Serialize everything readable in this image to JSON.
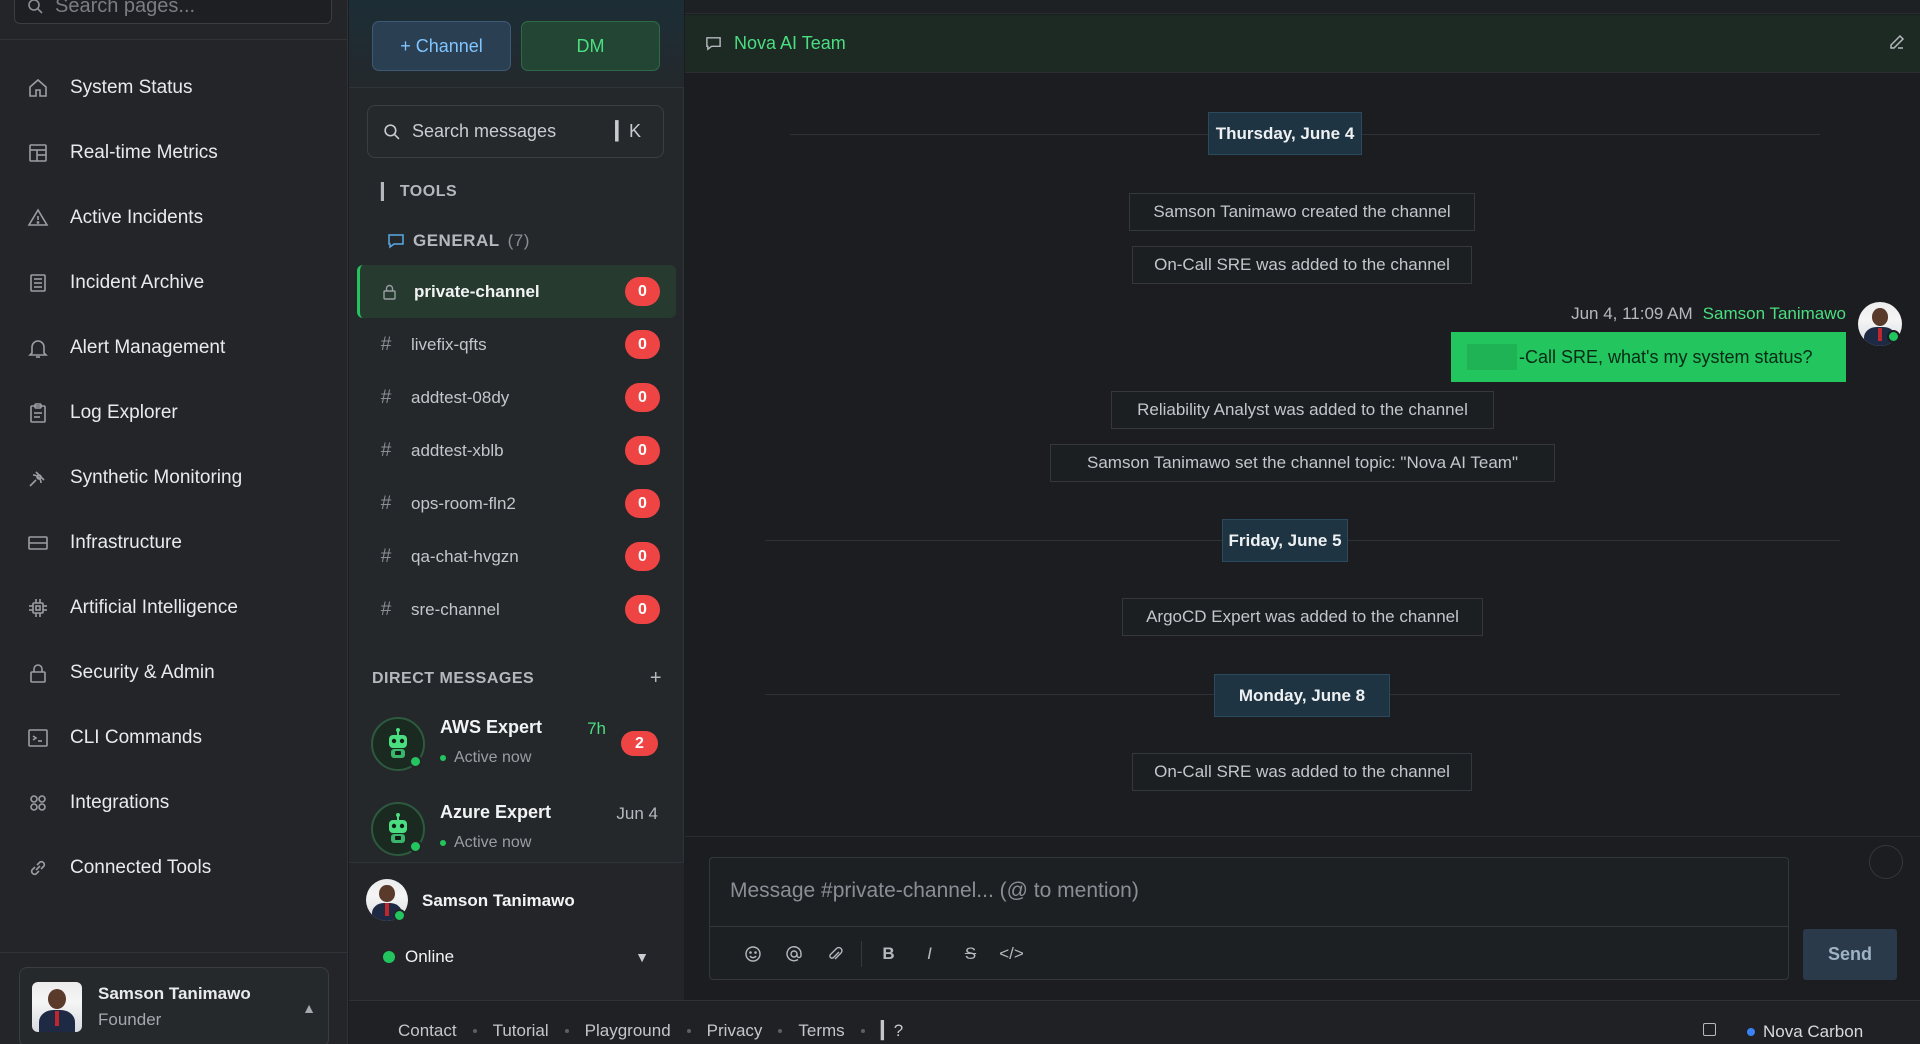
{
  "nav": {
    "search_placeholder": "Search pages...",
    "items": [
      {
        "label": "System Status",
        "icon": "home-icon"
      },
      {
        "label": "Real-time Metrics",
        "icon": "dashboard-icon"
      },
      {
        "label": "Active Incidents",
        "icon": "warning-icon"
      },
      {
        "label": "Incident Archive",
        "icon": "archive-icon"
      },
      {
        "label": "Alert Management",
        "icon": "bell-icon"
      },
      {
        "label": "Log Explorer",
        "icon": "clipboard-icon"
      },
      {
        "label": "Synthetic Monitoring",
        "icon": "satellite-icon"
      },
      {
        "label": "Infrastructure",
        "icon": "server-icon"
      },
      {
        "label": "Artificial Intelligence",
        "icon": "chip-icon"
      },
      {
        "label": "Security & Admin",
        "icon": "lock-icon"
      },
      {
        "label": "CLI Commands",
        "icon": "terminal-icon"
      },
      {
        "label": "Integrations",
        "icon": "grid-icon"
      },
      {
        "label": "Connected Tools",
        "icon": "link-icon"
      }
    ],
    "user": {
      "name": "Samson Tanimawo",
      "role": "Founder"
    }
  },
  "channels": {
    "new_channel_label": "+ Channel",
    "dm_label": "DM",
    "search_placeholder": "Search messages",
    "search_shortcut": "▎K",
    "tools_label": "TOOLS",
    "tools_prefix": "▎",
    "general_label": "GENERAL",
    "general_count": "(7)",
    "list": [
      {
        "name": "private-channel",
        "type": "private",
        "unread": "0",
        "active": true
      },
      {
        "name": "livefix-qfts",
        "type": "public",
        "unread": "0"
      },
      {
        "name": "addtest-08dy",
        "type": "public",
        "unread": "0"
      },
      {
        "name": "addtest-xblb",
        "type": "public",
        "unread": "0"
      },
      {
        "name": "ops-room-fln2",
        "type": "public",
        "unread": "0"
      },
      {
        "name": "qa-chat-hvgzn",
        "type": "public",
        "unread": "0"
      },
      {
        "name": "sre-channel",
        "type": "public",
        "unread": "0"
      }
    ],
    "hash_symbol": "#",
    "dm_header": "DIRECT MESSAGES",
    "dm_add": "+",
    "dms": [
      {
        "name": "AWS Expert",
        "status": "Active now",
        "time": "7h",
        "unread": "2",
        "time_color": "#4ade80"
      },
      {
        "name": "Azure Expert",
        "status": "Active now",
        "time": "Jun 4",
        "time_color": "#b5b9be"
      }
    ],
    "current_user": {
      "name": "Samson Tanimawo",
      "status": "Online",
      "dropdown": "▼"
    }
  },
  "chat": {
    "channel_title": "Nova AI Team",
    "days": [
      "Thursday, June 4",
      "Friday, June 5",
      "Monday, June 8"
    ],
    "system_messages": [
      "Samson Tanimawo created the channel",
      "On-Call SRE was added to the channel",
      "Reliability Analyst was added to the channel",
      "Samson Tanimawo set the channel topic: \"Nova AI Team\"",
      "ArgoCD Expert was added to the channel",
      "On-Call SRE was added to the channel"
    ],
    "message": {
      "timestamp": "Jun 4, 11:09 AM",
      "author": "Samson Tanimawo",
      "text": "-Call SRE, what's my system status?"
    },
    "composer": {
      "placeholder": "Message #private-channel... (@ to mention)",
      "bold": "B",
      "italic": "I",
      "strike": "S",
      "code": "</>",
      "send": "Send"
    }
  },
  "footer": {
    "links": [
      "Contact",
      "Tutorial",
      "Playground",
      "Privacy",
      "Terms",
      "▎?"
    ],
    "brand": "Nova Carbon"
  },
  "colors": {
    "accent_green": "#22c55e",
    "accent_blue": "#7fc4ff",
    "badge_red": "#ef4444",
    "background": "#1a1c1f"
  }
}
